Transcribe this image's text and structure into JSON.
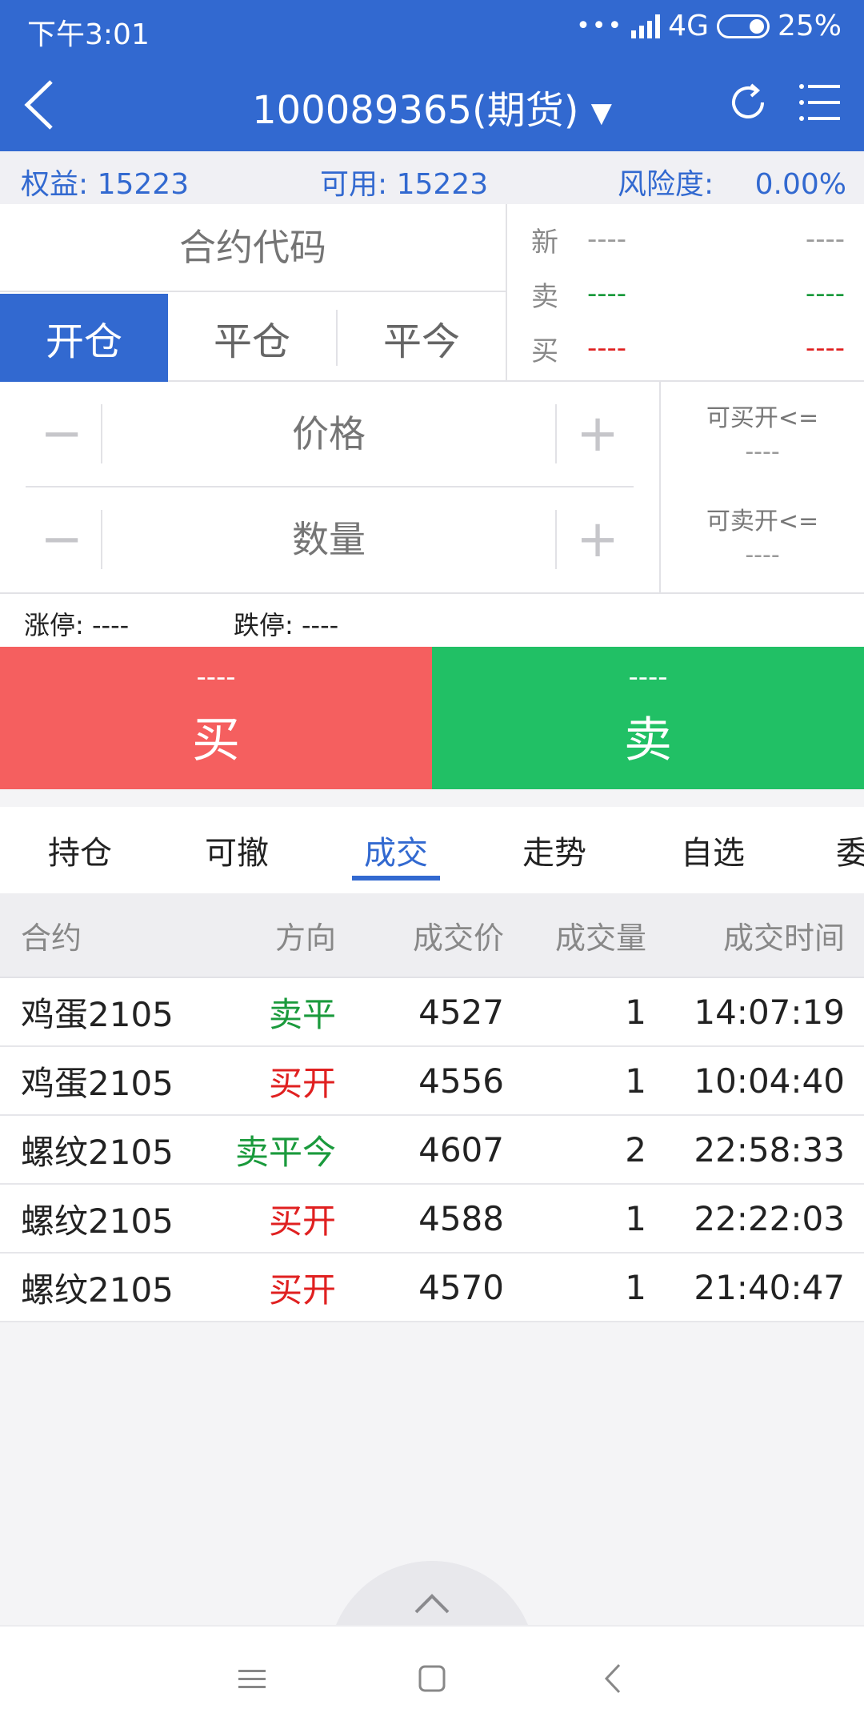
{
  "status_bar": {
    "time": "下午3:01",
    "network": "4G",
    "battery": "25%"
  },
  "header": {
    "title": "100089365(期货)",
    "dropdown_glyph": "▼",
    "colors": {
      "primary": "#3269d0"
    }
  },
  "account": {
    "equity_label": "权益:",
    "equity_value": "15223",
    "available_label": "可用:",
    "available_value": "15223",
    "risk_label": "风险度:",
    "risk_value": "0.00%"
  },
  "order": {
    "contract_placeholder": "合约代码",
    "position_tabs": [
      "开仓",
      "平仓",
      "平今"
    ],
    "selected_tab": "开仓",
    "quote": {
      "rows": [
        {
          "label": "新",
          "v1": "----",
          "v2": "----",
          "color": "#999999"
        },
        {
          "label": "卖",
          "v1": "----",
          "v2": "----",
          "color": "#1a9a3c"
        },
        {
          "label": "买",
          "v1": "----",
          "v2": "----",
          "color": "#e02020"
        }
      ]
    },
    "price_placeholder": "价格",
    "quantity_placeholder": "数量",
    "minus": "−",
    "plus": "+",
    "can_buy_open_label": "可买开<=",
    "can_buy_open_value": "----",
    "can_sell_open_label": "可卖开<=",
    "can_sell_open_value": "----",
    "limit_up_label": "涨停:",
    "limit_up_value": "----",
    "limit_down_label": "跌停:",
    "limit_down_value": "----",
    "buy_price": "----",
    "buy_label": "买",
    "sell_price": "----",
    "sell_label": "卖"
  },
  "tabs": {
    "items": [
      "持仓",
      "可撤",
      "成交",
      "走势",
      "自选",
      "委"
    ],
    "active": "成交"
  },
  "trades": {
    "headers": {
      "name": "合约",
      "direction": "方向",
      "price": "成交价",
      "qty": "成交量",
      "time": "成交时间"
    },
    "rows": [
      {
        "name": "鸡蛋2105",
        "direction": "卖平",
        "dir_color": "#1a9a3c",
        "price": "4527",
        "qty": "1",
        "time": "14:07:19"
      },
      {
        "name": "鸡蛋2105",
        "direction": "买开",
        "dir_color": "#e02020",
        "price": "4556",
        "qty": "1",
        "time": "10:04:40"
      },
      {
        "name": "螺纹2105",
        "direction": "卖平今",
        "dir_color": "#1a9a3c",
        "price": "4607",
        "qty": "2",
        "time": "22:58:33"
      },
      {
        "name": "螺纹2105",
        "direction": "买开",
        "dir_color": "#e02020",
        "price": "4588",
        "qty": "1",
        "time": "22:22:03"
      },
      {
        "name": "螺纹2105",
        "direction": "买开",
        "dir_color": "#e02020",
        "price": "4570",
        "qty": "1",
        "time": "21:40:47"
      }
    ]
  }
}
